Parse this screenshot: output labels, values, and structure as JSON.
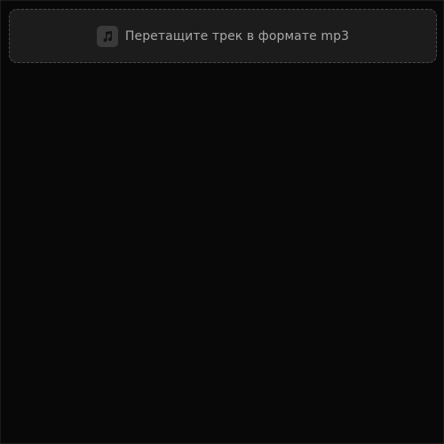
{
  "dropzone": {
    "label": "Перетащите трек в формате mp3",
    "icon": "music-note-icon"
  },
  "colors": {
    "background": "#080808",
    "dropzone_fill": "#1c1c1c",
    "dropzone_border": "#4a4a4a",
    "icon_tile": "#3a3a3a",
    "text": "#a9a9a9"
  }
}
